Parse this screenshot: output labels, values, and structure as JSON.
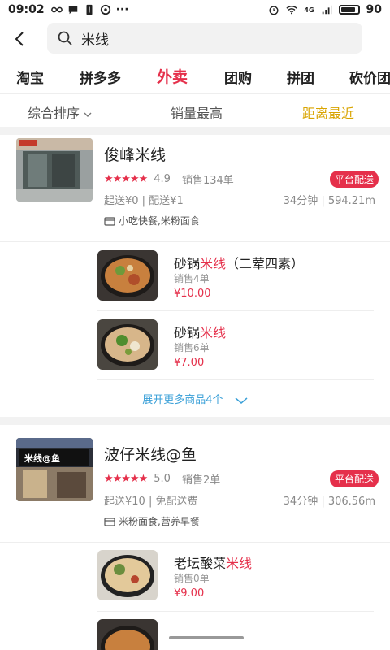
{
  "status": {
    "time": "09:02",
    "battery": "90",
    "net": "4G"
  },
  "search": {
    "value": "米线"
  },
  "tabs": [
    "淘宝",
    "拼多多",
    "外卖",
    "团购",
    "拼团",
    "砍价团"
  ],
  "sort": {
    "comprehensive": "综合排序",
    "sales": "销量最高",
    "distance": "距离最近"
  },
  "shops": [
    {
      "name": "俊峰米线",
      "stars": "★★★★★",
      "rating": "4.9",
      "sales": "销售134单",
      "badge": "平台配送",
      "delivery": "起送¥0 | 配送¥1",
      "distance": "34分钟 | 594.21m",
      "categories": "小吃快餐,米粉面食",
      "dishes": [
        {
          "pre": "砂锅",
          "hl": "米线",
          "post": "（二荤四素）",
          "sales": "销售4单",
          "price": "¥10.00"
        },
        {
          "pre": "砂锅",
          "hl": "米线",
          "post": "",
          "sales": "销售6单",
          "price": "¥7.00"
        }
      ],
      "expand": "展开更多商品4个"
    },
    {
      "name": "波仔米线@鱼",
      "stars": "★★★★★",
      "rating": "5.0",
      "sales": "销售2单",
      "badge": "平台配送",
      "delivery": "起送¥10 | 免配送费",
      "distance": "34分钟 | 306.56m",
      "categories": "米粉面食,营养早餐",
      "sign_text": "米线@鱼",
      "dishes": [
        {
          "pre": "老坛酸菜",
          "hl": "米线",
          "post": "",
          "sales": "销售0单",
          "price": "¥9.00"
        }
      ]
    }
  ]
}
